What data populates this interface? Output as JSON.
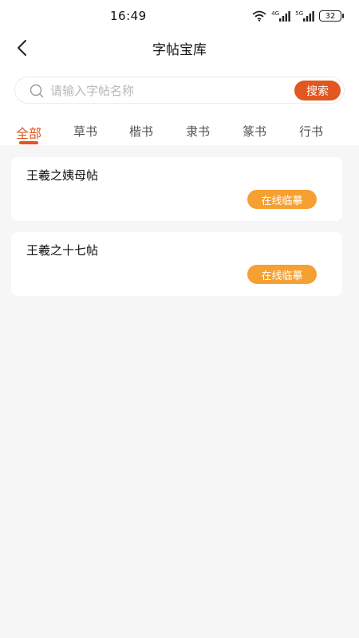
{
  "status_bar": {
    "time": "16:49",
    "battery": "32",
    "network_labels": [
      "4G",
      "5G"
    ],
    "icons": [
      "wifi-icon",
      "signal-icon",
      "signal-icon",
      "battery-icon"
    ]
  },
  "header": {
    "title": "字帖宝库",
    "back_icon": "chevron-left-icon"
  },
  "search": {
    "placeholder": "请输入字帖名称",
    "value": "",
    "button_label": "搜索",
    "icon": "search-icon"
  },
  "tabs": [
    {
      "label": "全部",
      "active": true
    },
    {
      "label": "草书",
      "active": false
    },
    {
      "label": "楷书",
      "active": false
    },
    {
      "label": "隶书",
      "active": false
    },
    {
      "label": "篆书",
      "active": false
    },
    {
      "label": "行书",
      "active": false
    }
  ],
  "items": [
    {
      "title": "王羲之姨母帖",
      "action_label": "在线临摹"
    },
    {
      "title": "王羲之十七帖",
      "action_label": "在线临摹"
    }
  ],
  "colors": {
    "accent": "#e2561f",
    "action": "#f5a033",
    "background": "#f6f6f6",
    "card": "#ffffff"
  }
}
